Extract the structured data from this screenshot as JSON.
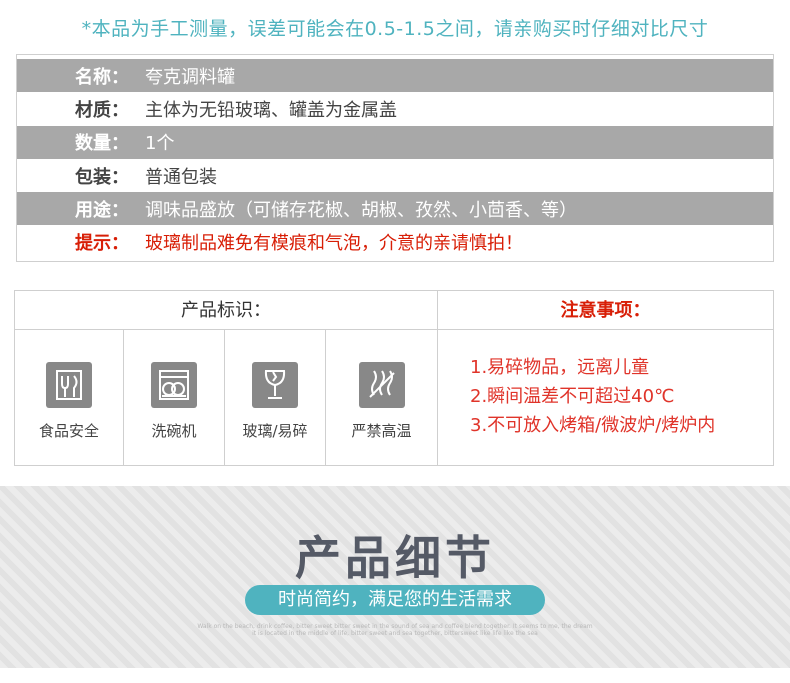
{
  "note": "*本品为手工测量，误差可能会在0.5-1.5之间，请亲购买时仔细对比尺寸",
  "spec": [
    {
      "key": "名称：",
      "value": "夸克调料罐"
    },
    {
      "key": "材质：",
      "value": "主体为无铅玻璃、罐盖为金属盖"
    },
    {
      "key": "数量：",
      "value": "1个"
    },
    {
      "key": "包装：",
      "value": "普通包装"
    },
    {
      "key": "用途：",
      "value": "调味品盛放（可储存花椒、胡椒、孜然、小茴香、等）"
    },
    {
      "key": "提示：",
      "value": "玻璃制品难免有模痕和气泡，介意的亲请慎拍！"
    }
  ],
  "icons_header": "产品标识：",
  "notice_header": "注意事项：",
  "icons": [
    {
      "icon": "food-safe-icon",
      "label": "食品安全"
    },
    {
      "icon": "dishwasher-icon",
      "label": "洗碗机"
    },
    {
      "icon": "glass-fragile-icon",
      "label": "玻璃/易碎"
    },
    {
      "icon": "no-high-temp-icon",
      "label": "严禁高温"
    }
  ],
  "notices": [
    "1.易碎物品，远离儿童",
    "2.瞬间温差不可超过40℃",
    "3.不可放入烤箱/微波炉/烤炉内"
  ],
  "banner": {
    "title": "产品细节",
    "subtitle": "时尚简约，满足您的生活需求",
    "fine_print": "Walk on the beach, drink coffee, bitter sweet bitter sweet in the sound of sea and coffee blend together. It seems to me, the dream it is located in the middle of life, bitter sweet and sea together, bittersweet like life like the sea"
  },
  "colors": {
    "accent": "#4fb3bf",
    "warn": "#d81e06",
    "row_dark": "#a8a8a8"
  }
}
